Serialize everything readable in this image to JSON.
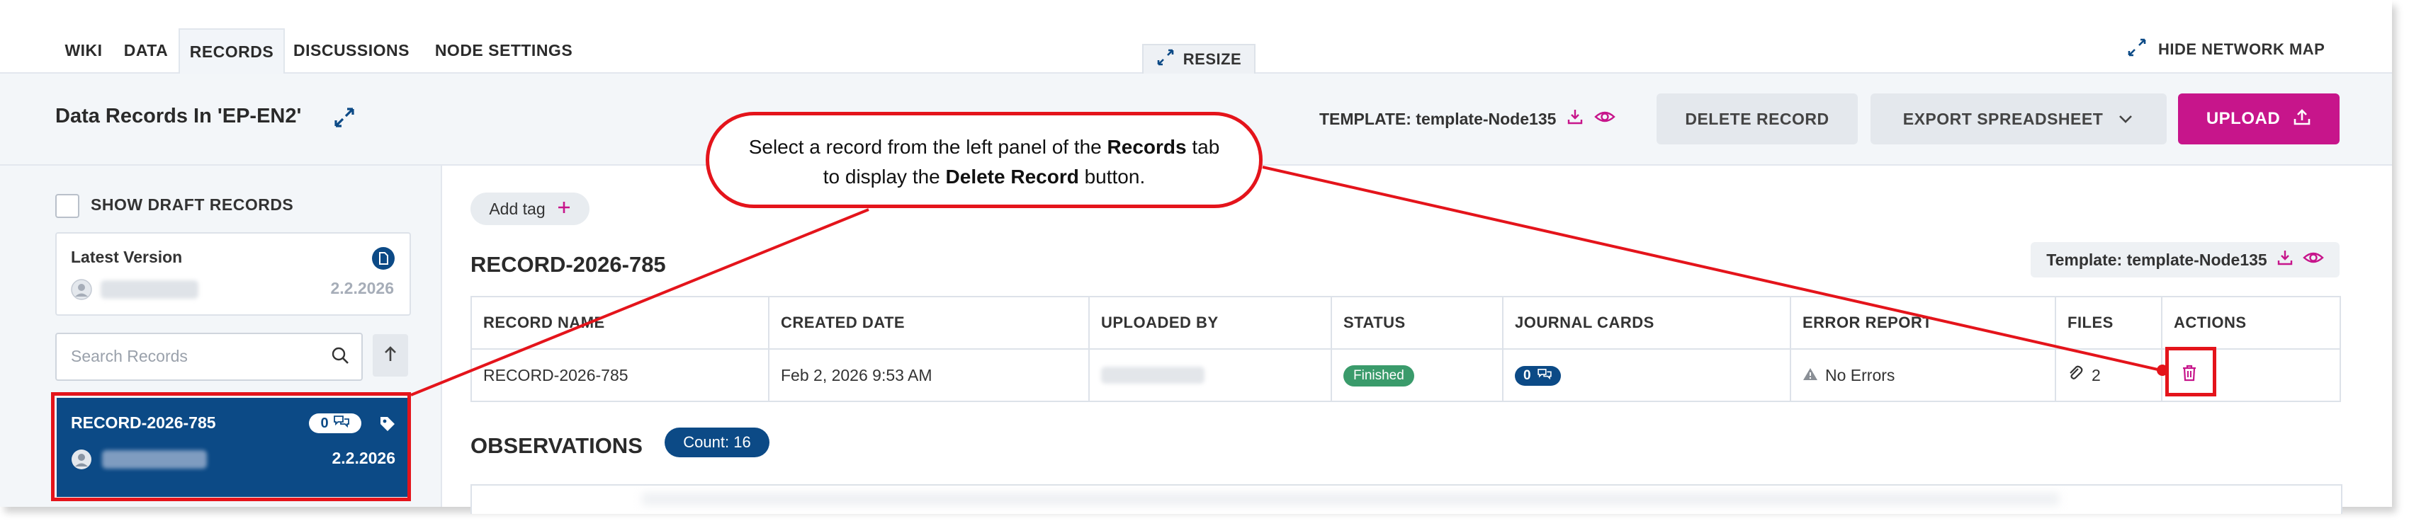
{
  "nav": {
    "tabs": [
      "WIKI",
      "DATA",
      "RECORDS",
      "DISCUSSIONS",
      "NODE SETTINGS"
    ],
    "active_tab": "RECORDS",
    "resize_label": "RESIZE",
    "hide_map_label": "HIDE NETWORK MAP"
  },
  "header": {
    "title": "Data Records In 'EP-EN2'",
    "template_label": "TEMPLATE: template-Node135",
    "delete_label": "DELETE RECORD",
    "export_label": "EXPORT SPREADSHEET",
    "upload_label": "UPLOAD"
  },
  "sidebar": {
    "show_drafts_label": "SHOW DRAFT RECORDS",
    "version_card": {
      "title": "Latest Version",
      "version": "2.2.2026"
    },
    "search_placeholder": "Search Records",
    "records": [
      {
        "name": "RECORD-2026-785",
        "count": "0",
        "date": "2.2.2026"
      }
    ]
  },
  "main": {
    "add_tag_label": "Add tag",
    "record_title": "RECORD-2026-785",
    "template_badge": "Template: template-Node135",
    "table": {
      "headers": [
        "RECORD NAME",
        "CREATED DATE",
        "UPLOADED BY",
        "STATUS",
        "JOURNAL CARDS",
        "ERROR REPORT",
        "FILES",
        "ACTIONS"
      ],
      "row": {
        "record_name": "RECORD-2026-785",
        "created_date": "Feb 2, 2026 9:53 AM",
        "status": "Finished",
        "journal_cards": "0",
        "error_report": "No Errors",
        "files": "2"
      }
    },
    "observations_title": "OBSERVATIONS",
    "observations_count": "Count: 16"
  },
  "callout": {
    "line1_pre": "Select a record from the left panel of the ",
    "line1_bold": "Records",
    "line1_post": " tab",
    "line2_pre": "to display the ",
    "line2_bold": "Delete Record",
    "line2_post": " button."
  },
  "colors": {
    "brand_blue": "#0c4a86",
    "upload_magenta": "#c7158b",
    "annotation_red": "#e4141b",
    "status_green": "#3a9b6b"
  }
}
